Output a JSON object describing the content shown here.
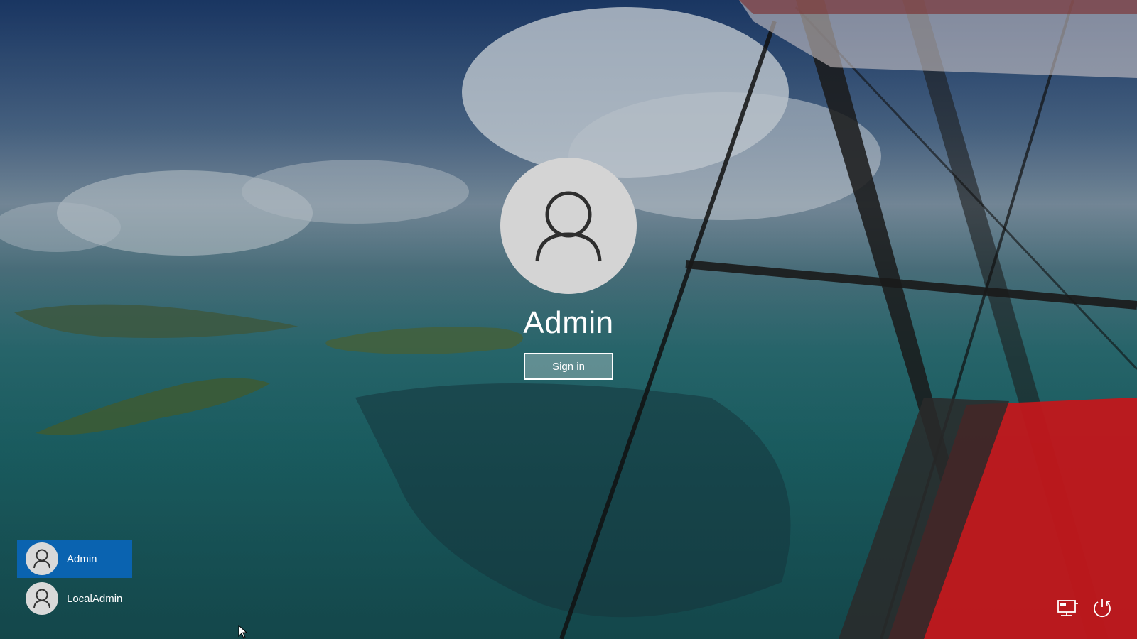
{
  "lock_screen": {
    "user_name": "Admin",
    "signin_label": "Sign in"
  },
  "user_list": {
    "items": [
      {
        "label": "Admin",
        "selected": true
      },
      {
        "label": "LocalAdmin",
        "selected": false
      }
    ]
  },
  "corner_icons": {
    "network": "network-icon",
    "power": "power-icon"
  },
  "colors": {
    "selected_user_bg": "#0a63b0",
    "avatar_bg": "#d4d4d4",
    "avatar_glyph": "#333333"
  }
}
